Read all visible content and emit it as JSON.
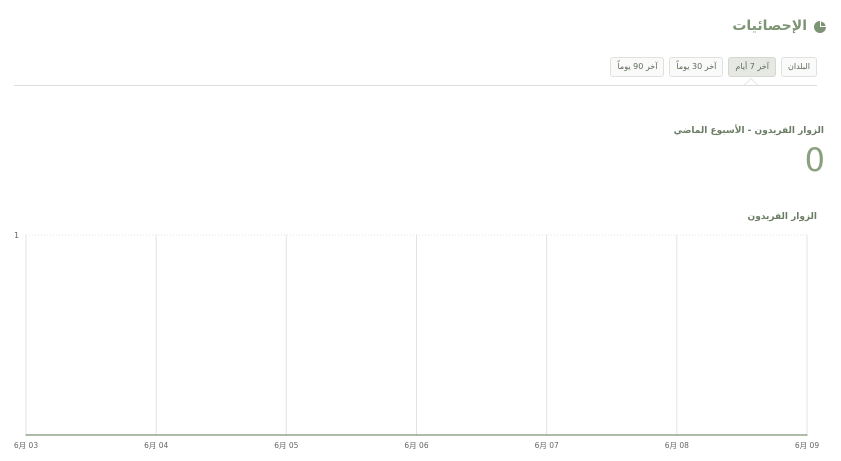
{
  "header": {
    "title": "الإحصائيات",
    "icon": "pie-chart-icon"
  },
  "tabs": [
    {
      "label": "البلدان",
      "active": false
    },
    {
      "label": "آخر 7 أيام",
      "active": true
    },
    {
      "label": "آخر 30 يوماً",
      "active": false
    },
    {
      "label": "آخر 90 يوماً",
      "active": false
    }
  ],
  "stats": {
    "label": "الزوار الفريدون - الأسبوع الماضي",
    "value": "0"
  },
  "chart": {
    "title": "الزوار الفريدون"
  },
  "colors": {
    "accent": "#7d9474",
    "grid": "#e3e3e3",
    "axis": "#7e8a73"
  },
  "chart_data": {
    "type": "line",
    "categories": [
      "6月 03",
      "6月 04",
      "6月 05",
      "6月 06",
      "6月 07",
      "6月 08",
      "6月 09"
    ],
    "series": [
      {
        "values": [
          0,
          0,
          0,
          0,
          0,
          0,
          0
        ]
      }
    ],
    "ylim": [
      0,
      1
    ],
    "yticks": [
      "1"
    ],
    "xlabel": "",
    "ylabel": "",
    "grid": true
  }
}
